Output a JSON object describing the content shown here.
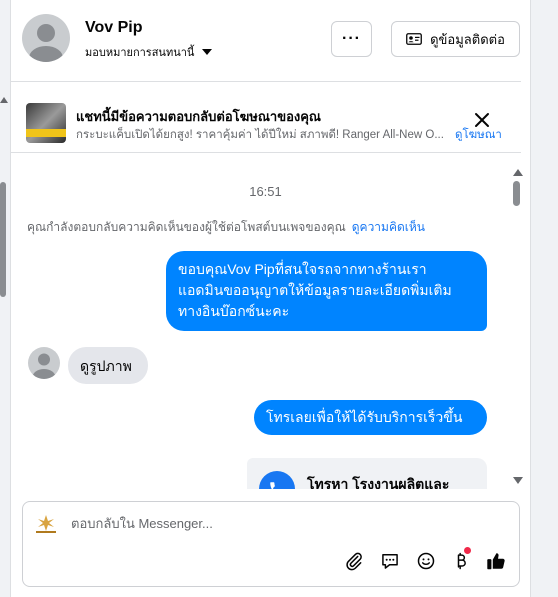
{
  "header": {
    "contact_name": "Vov Pip",
    "assign_label": "มอบหมายการสนทนานี้",
    "more_label": "···",
    "contact_info_label": "ดูข้อมูลติดต่อ"
  },
  "ad_banner": {
    "title": "แชทนี้มีข้อความตอบกลับต่อโฆษณาของคุณ",
    "description": "กระบะแค็บเปิดได้ยกสูง! ราคาคุ้มค่า ได้ปีใหม่ สภาพดี! Ranger All-New O...",
    "link_label": "ดูโฆษณา"
  },
  "conversation": {
    "timestamp": "16:51",
    "comment_note": "คุณกำลังตอบกลับความคิดเห็นของผู้ใช้ต่อโพสต์บนเพจของคุณ",
    "comment_link": "ดูความคิดเห็น",
    "messages": [
      {
        "direction": "outgoing",
        "lines": [
          "ขอบคุณVov Pipที่สนใจรถจากทางร้านเรา",
          "แอดมินขออนุญาตให้ข้อมูลรายละเอียดพิ่มเติม",
          "ทางอินบ๊อกซ์นะคะ"
        ]
      },
      {
        "direction": "incoming",
        "text": "ดูรูปภาพ"
      },
      {
        "direction": "outgoing",
        "text": "โทรเลยเพื่อให้ได้รับบริการเร็วขึ้น"
      },
      {
        "direction": "outgoing",
        "type": "call_card",
        "text": "โทรหา โรงงานผลิตและ"
      }
    ]
  },
  "composer": {
    "placeholder": "ตอบกลับใน Messenger...",
    "tools": [
      "paperclip-icon",
      "saved-replies-icon",
      "emoji-icon",
      "payment-icon",
      "like-icon"
    ]
  },
  "colors": {
    "accent": "#0084ff",
    "link": "#1877f2",
    "incoming_bubble": "#e4e6eb",
    "notification_dot": "#f02849"
  }
}
